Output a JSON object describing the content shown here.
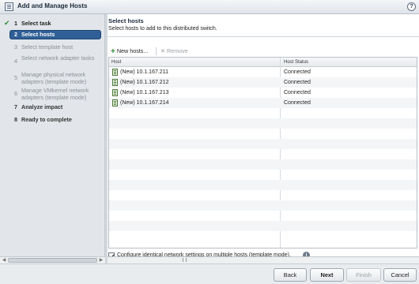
{
  "window": {
    "title": "Add and Manage Hosts",
    "help_glyph": "?"
  },
  "wizard_steps": [
    {
      "num": "1",
      "label": "Select task",
      "state": "done"
    },
    {
      "num": "2",
      "label": "Select hosts",
      "state": "active"
    },
    {
      "num": "3",
      "label": "Select template host",
      "state": "pending"
    },
    {
      "num": "4",
      "label": "Select network adapter tasks",
      "state": "pending"
    },
    {
      "num": "5",
      "label": "Manage physical network adapters (template mode)",
      "state": "pending"
    },
    {
      "num": "6",
      "label": "Manage VMkernel network adapters (template mode)",
      "state": "pending"
    },
    {
      "num": "7",
      "label": "Analyze impact",
      "state": "next"
    },
    {
      "num": "8",
      "label": "Ready to complete",
      "state": "next"
    }
  ],
  "main": {
    "title": "Select hosts",
    "subtitle": "Select hosts to add to this distributed switch.",
    "toolbar": {
      "new_hosts_label": "New hosts...",
      "remove_label": "Remove"
    },
    "grid": {
      "columns": [
        "Host",
        "Host Status"
      ],
      "rows": [
        {
          "host": "(New) 10.1.167.211",
          "status": "Connected"
        },
        {
          "host": "(New) 10.1.167.212",
          "status": "Connected"
        },
        {
          "host": "(New) 10.1.167.213",
          "status": "Connected"
        },
        {
          "host": "(New) 10.1.167.214",
          "status": "Connected"
        }
      ]
    },
    "template_mode": {
      "label": "Configure identical network settings on multiple hosts (template mode).",
      "checked": true
    }
  },
  "footer": {
    "back": "Back",
    "next": "Next",
    "finish": "Finish",
    "cancel": "Cancel"
  }
}
